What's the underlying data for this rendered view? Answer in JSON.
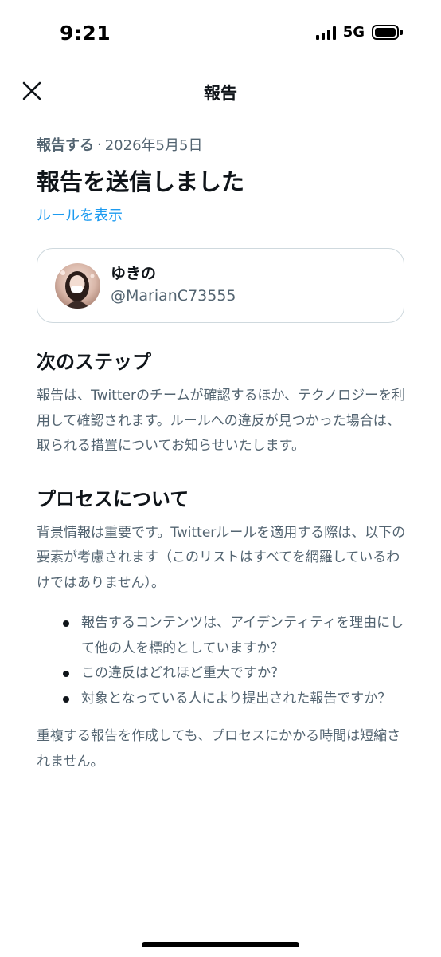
{
  "status_bar": {
    "time": "9:21",
    "network": "5G"
  },
  "header": {
    "title": "報告"
  },
  "report": {
    "meta_label": "報告する",
    "separator": "·",
    "date": "2026年5月5日",
    "title": "報告を送信しました",
    "rules_link": "ルールを表示"
  },
  "user": {
    "name": "ゆきの",
    "handle": "@MarianC73555"
  },
  "next_steps": {
    "title": "次のステップ",
    "body": "報告は、Twitterのチームが確認するほか、テクノロジーを利用して確認されます。ルールへの違反が見つかった場合は、取られる措置についてお知らせいたします。"
  },
  "process": {
    "title": "プロセスについて",
    "intro": "背景情報は重要です。Twitterルールを適用する際は、以下の要素が考慮されます（このリストはすべてを網羅しているわけではありません）。",
    "bullets": [
      "報告するコンテンツは、アイデンティティを理由にして他の人を標的としていますか？",
      "この違反はどれほど重大ですか？",
      "対象となっている人により提出された報告ですか？"
    ],
    "footer": "重複する報告を作成しても、プロセスにかかる時間は短縮されません。"
  },
  "colors": {
    "accent": "#1d9bf0",
    "secondary_text": "#536471",
    "primary_text": "#0f1419",
    "border": "#cfd9de"
  },
  "icons": {
    "close": "close-icon",
    "signal": "signal-icon",
    "battery": "battery-icon"
  }
}
